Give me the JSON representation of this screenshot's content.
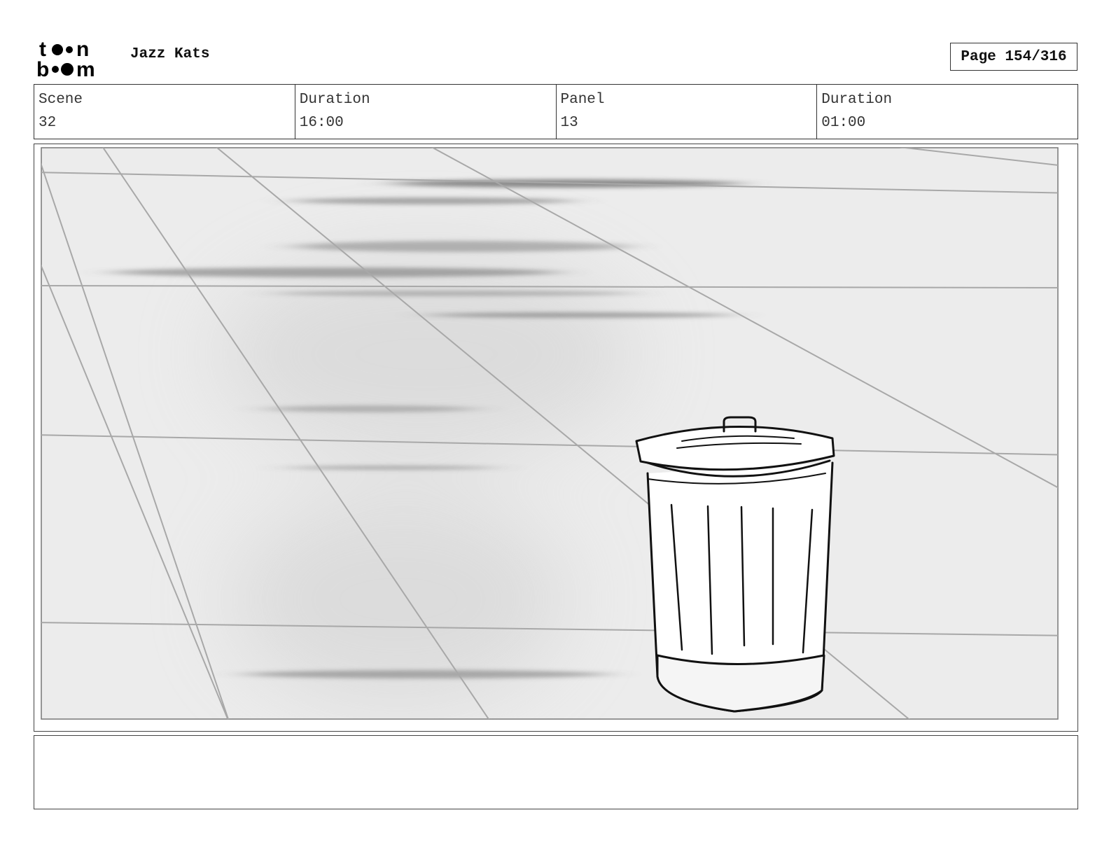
{
  "header": {
    "logo_text": "toon boom",
    "project_title": "Jazz Kats",
    "page_label": "Page 154/316"
  },
  "info": {
    "scene_label": "Scene",
    "scene_value": "32",
    "scene_duration_label": "Duration",
    "scene_duration_value": "16:00",
    "panel_label": "Panel",
    "panel_value": "13",
    "panel_duration_label": "Duration",
    "panel_duration_value": "01:00"
  },
  "notes": {
    "text": ""
  }
}
